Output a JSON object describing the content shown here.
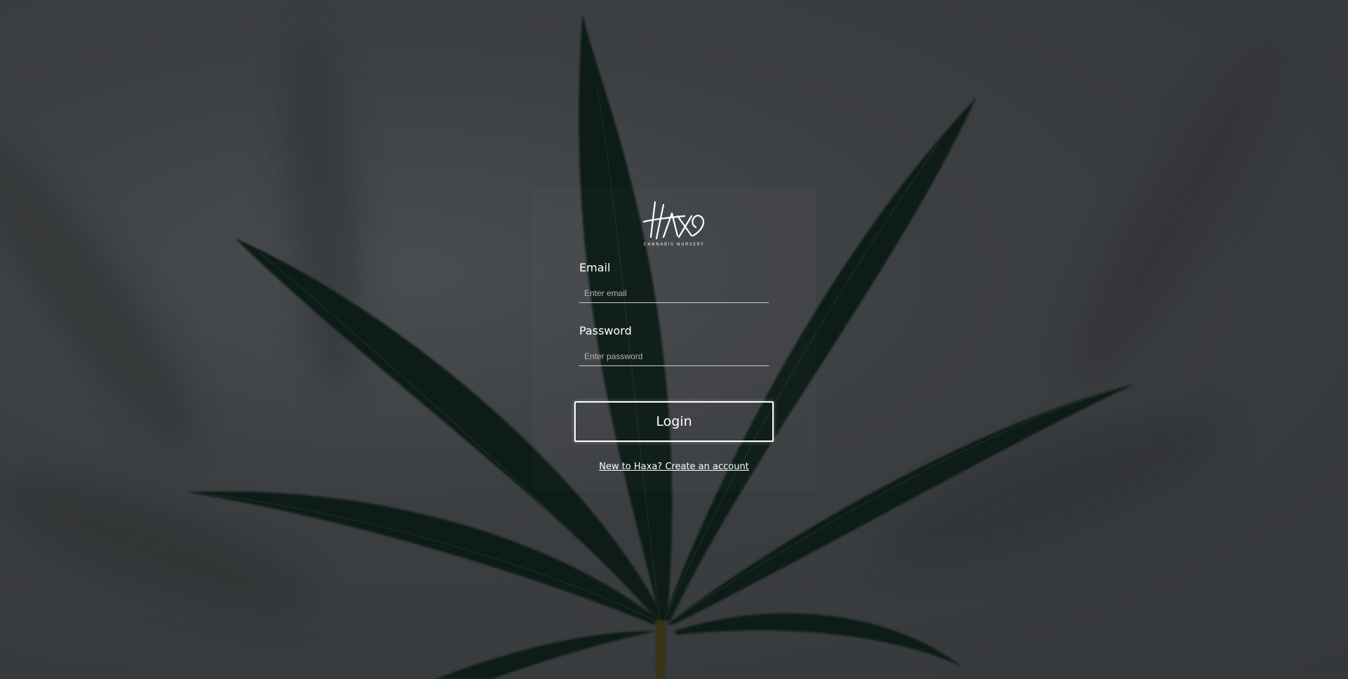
{
  "brand": {
    "logo_text": "HAXA",
    "logo_subtitle": "CANNABIS NURSERY"
  },
  "form": {
    "email_label": "Email",
    "email_placeholder": "Enter email",
    "email_value": "",
    "password_label": "Password",
    "password_placeholder": "Enter password",
    "password_value": "",
    "login_label": "Login",
    "signup_link": "New to Haxa? Create an account"
  },
  "colors": {
    "background": "#3b3e41",
    "leaf": "#0e1d12",
    "text": "#ffffff"
  },
  "icons": {
    "background_image": "cannabis-leaf"
  }
}
